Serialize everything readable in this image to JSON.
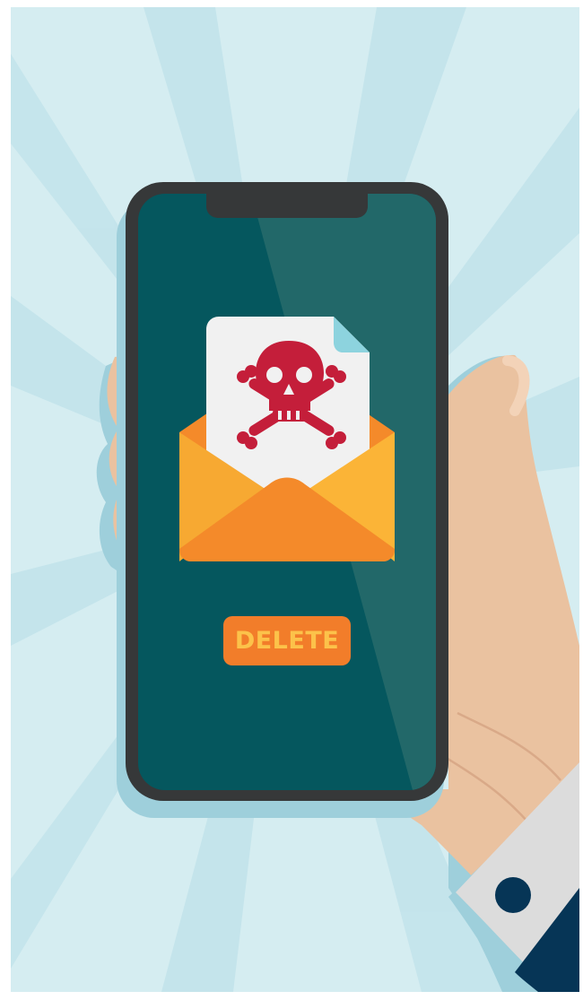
{
  "scene": {
    "phone_screen": {
      "action_button": {
        "label": "DELETE",
        "icon": "delete-button"
      },
      "email_icon": "open-envelope-icon",
      "document_icon": "document-icon",
      "threat_icon": "skull-and-crossbones-icon"
    }
  },
  "colors": {
    "background_light": "#d5edf1",
    "background_ray": "#b9e0e8",
    "phone_frame": "#363839",
    "phone_screen": "#05575e",
    "screen_glare": "#226869",
    "envelope_orange": "#f7a932",
    "envelope_flap": "#f48a2a",
    "skull_red": "#c41e3a",
    "paper": "#f1f1f1",
    "paper_fold": "#8dd3de",
    "button_bg": "#f27d2a",
    "button_text": "#fcc24a",
    "skin": "#eac2a0",
    "shirt_cuff": "#dcdcdc",
    "jacket": "#063556",
    "cufflink": "#063556"
  }
}
